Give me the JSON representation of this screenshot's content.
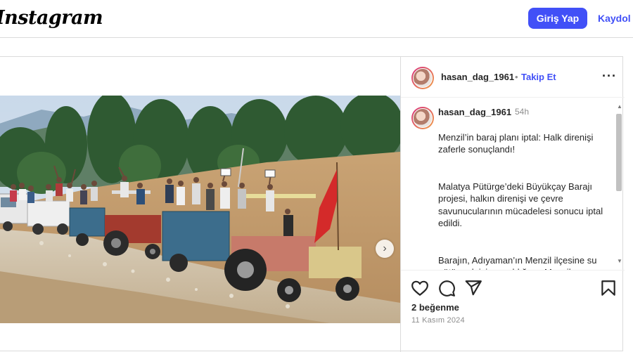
{
  "header": {
    "logo": "Instagram",
    "login_label": "Giriş Yap",
    "signup_label": "Kaydol"
  },
  "post": {
    "username": "hasan_dag_1961",
    "separator": "•",
    "follow_label": "Takip Et",
    "more_icon": "more-horizontal-icon",
    "caption": {
      "username": "hasan_dag_1961",
      "time": "54h",
      "paragraphs": [
        "Menzil’in baraj planı iptal: Halk direnişi zaferle sonuçlandı!",
        "Malatya Pütürge’deki Büyükçay Barajı projesi, halkın direnişi ve çevre savunucularının mücadelesi sonucu iptal edildi.",
        "Barajın, Adıyaman’ın Menzil ilçesine su götürmek için yapıldığı ve Menzil cemaatine yakın bir grup tarafından yapılacağı iddia edilmişti."
      ]
    },
    "media": {
      "description_icon": "photo-tractor-convoy",
      "next_icon": "chevron-right-icon"
    },
    "actions": {
      "like_icon": "heart-icon",
      "comment_icon": "comment-icon",
      "share_icon": "send-icon",
      "save_icon": "bookmark-icon"
    },
    "likes": "2 beğenme",
    "date": "11 Kasım 2024"
  },
  "colors": {
    "brand_blue": "#4150f7",
    "border": "#dbdbdb",
    "muted": "#8e8e8e"
  }
}
